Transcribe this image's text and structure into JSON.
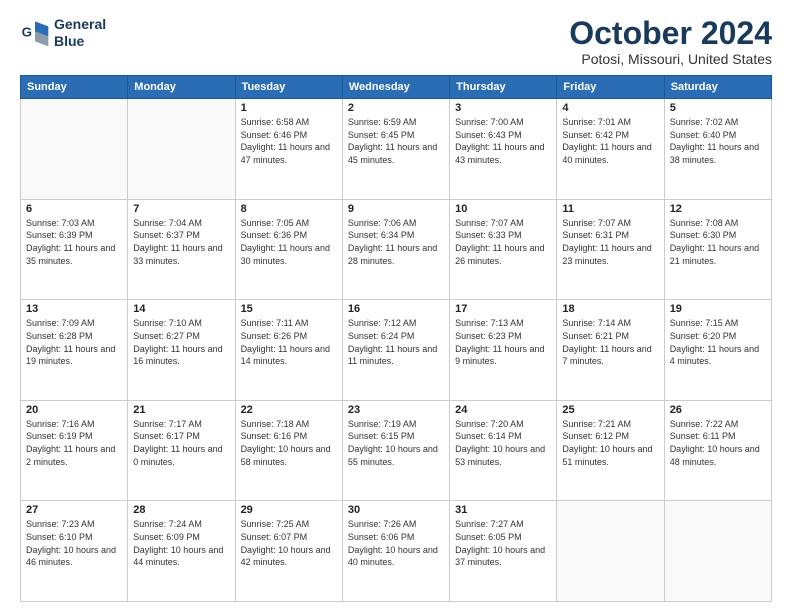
{
  "header": {
    "logo_line1": "General",
    "logo_line2": "Blue",
    "month": "October 2024",
    "location": "Potosi, Missouri, United States"
  },
  "days_of_week": [
    "Sunday",
    "Monday",
    "Tuesday",
    "Wednesday",
    "Thursday",
    "Friday",
    "Saturday"
  ],
  "weeks": [
    [
      {
        "day": "",
        "detail": ""
      },
      {
        "day": "",
        "detail": ""
      },
      {
        "day": "1",
        "detail": "Sunrise: 6:58 AM\nSunset: 6:46 PM\nDaylight: 11 hours and 47 minutes."
      },
      {
        "day": "2",
        "detail": "Sunrise: 6:59 AM\nSunset: 6:45 PM\nDaylight: 11 hours and 45 minutes."
      },
      {
        "day": "3",
        "detail": "Sunrise: 7:00 AM\nSunset: 6:43 PM\nDaylight: 11 hours and 43 minutes."
      },
      {
        "day": "4",
        "detail": "Sunrise: 7:01 AM\nSunset: 6:42 PM\nDaylight: 11 hours and 40 minutes."
      },
      {
        "day": "5",
        "detail": "Sunrise: 7:02 AM\nSunset: 6:40 PM\nDaylight: 11 hours and 38 minutes."
      }
    ],
    [
      {
        "day": "6",
        "detail": "Sunrise: 7:03 AM\nSunset: 6:39 PM\nDaylight: 11 hours and 35 minutes."
      },
      {
        "day": "7",
        "detail": "Sunrise: 7:04 AM\nSunset: 6:37 PM\nDaylight: 11 hours and 33 minutes."
      },
      {
        "day": "8",
        "detail": "Sunrise: 7:05 AM\nSunset: 6:36 PM\nDaylight: 11 hours and 30 minutes."
      },
      {
        "day": "9",
        "detail": "Sunrise: 7:06 AM\nSunset: 6:34 PM\nDaylight: 11 hours and 28 minutes."
      },
      {
        "day": "10",
        "detail": "Sunrise: 7:07 AM\nSunset: 6:33 PM\nDaylight: 11 hours and 26 minutes."
      },
      {
        "day": "11",
        "detail": "Sunrise: 7:07 AM\nSunset: 6:31 PM\nDaylight: 11 hours and 23 minutes."
      },
      {
        "day": "12",
        "detail": "Sunrise: 7:08 AM\nSunset: 6:30 PM\nDaylight: 11 hours and 21 minutes."
      }
    ],
    [
      {
        "day": "13",
        "detail": "Sunrise: 7:09 AM\nSunset: 6:28 PM\nDaylight: 11 hours and 19 minutes."
      },
      {
        "day": "14",
        "detail": "Sunrise: 7:10 AM\nSunset: 6:27 PM\nDaylight: 11 hours and 16 minutes."
      },
      {
        "day": "15",
        "detail": "Sunrise: 7:11 AM\nSunset: 6:26 PM\nDaylight: 11 hours and 14 minutes."
      },
      {
        "day": "16",
        "detail": "Sunrise: 7:12 AM\nSunset: 6:24 PM\nDaylight: 11 hours and 11 minutes."
      },
      {
        "day": "17",
        "detail": "Sunrise: 7:13 AM\nSunset: 6:23 PM\nDaylight: 11 hours and 9 minutes."
      },
      {
        "day": "18",
        "detail": "Sunrise: 7:14 AM\nSunset: 6:21 PM\nDaylight: 11 hours and 7 minutes."
      },
      {
        "day": "19",
        "detail": "Sunrise: 7:15 AM\nSunset: 6:20 PM\nDaylight: 11 hours and 4 minutes."
      }
    ],
    [
      {
        "day": "20",
        "detail": "Sunrise: 7:16 AM\nSunset: 6:19 PM\nDaylight: 11 hours and 2 minutes."
      },
      {
        "day": "21",
        "detail": "Sunrise: 7:17 AM\nSunset: 6:17 PM\nDaylight: 11 hours and 0 minutes."
      },
      {
        "day": "22",
        "detail": "Sunrise: 7:18 AM\nSunset: 6:16 PM\nDaylight: 10 hours and 58 minutes."
      },
      {
        "day": "23",
        "detail": "Sunrise: 7:19 AM\nSunset: 6:15 PM\nDaylight: 10 hours and 55 minutes."
      },
      {
        "day": "24",
        "detail": "Sunrise: 7:20 AM\nSunset: 6:14 PM\nDaylight: 10 hours and 53 minutes."
      },
      {
        "day": "25",
        "detail": "Sunrise: 7:21 AM\nSunset: 6:12 PM\nDaylight: 10 hours and 51 minutes."
      },
      {
        "day": "26",
        "detail": "Sunrise: 7:22 AM\nSunset: 6:11 PM\nDaylight: 10 hours and 48 minutes."
      }
    ],
    [
      {
        "day": "27",
        "detail": "Sunrise: 7:23 AM\nSunset: 6:10 PM\nDaylight: 10 hours and 46 minutes."
      },
      {
        "day": "28",
        "detail": "Sunrise: 7:24 AM\nSunset: 6:09 PM\nDaylight: 10 hours and 44 minutes."
      },
      {
        "day": "29",
        "detail": "Sunrise: 7:25 AM\nSunset: 6:07 PM\nDaylight: 10 hours and 42 minutes."
      },
      {
        "day": "30",
        "detail": "Sunrise: 7:26 AM\nSunset: 6:06 PM\nDaylight: 10 hours and 40 minutes."
      },
      {
        "day": "31",
        "detail": "Sunrise: 7:27 AM\nSunset: 6:05 PM\nDaylight: 10 hours and 37 minutes."
      },
      {
        "day": "",
        "detail": ""
      },
      {
        "day": "",
        "detail": ""
      }
    ]
  ]
}
